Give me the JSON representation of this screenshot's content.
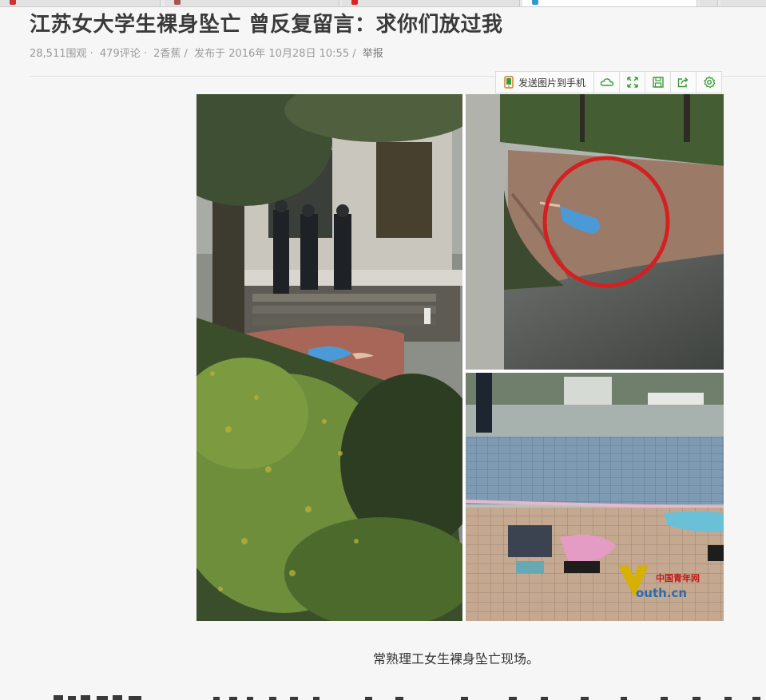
{
  "article": {
    "title": "江苏女大学生裸身坠亡 曾反复留言：求你们放过我",
    "meta": {
      "views": "28,511围观 ·",
      "comments": "479评论 ·",
      "bananas": "2香蕉 /",
      "published": "发布于 2016年 10月28日 10:55 /",
      "report": "举报"
    },
    "caption": "常熟理工女生裸身坠亡现场。"
  },
  "toolbar": {
    "send_label": "发送图片到手机",
    "icons": [
      "phone-icon",
      "cloud-icon",
      "fullscreen-icon",
      "save-icon",
      "share-icon",
      "settings-icon"
    ]
  },
  "photo": {
    "watermark_brand": "中国青年网",
    "watermark_text": "outh.cn"
  },
  "colors": {
    "accent_green": "#3a9a3a",
    "circle_red": "#d42020",
    "title_color": "#3a3a3a",
    "meta_color": "#9a9a9a"
  }
}
